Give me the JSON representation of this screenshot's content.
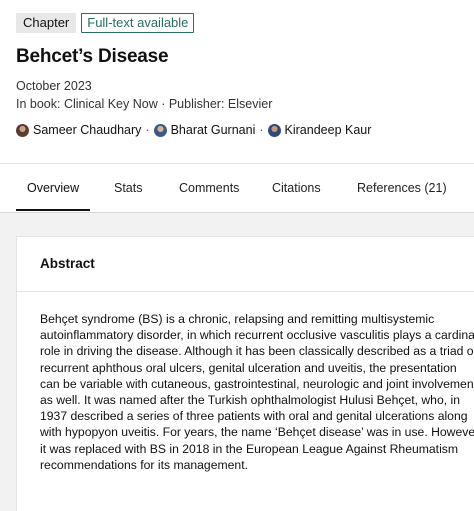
{
  "badges": {
    "chapter": "Chapter",
    "fulltext": "Full-text available"
  },
  "title": "Behcet’s Disease",
  "date": "October 2023",
  "book_line": "In book: Clinical Key Now · Publisher: Elsevier",
  "authors": [
    {
      "name": "Sameer Chaudhary",
      "icon": "author-avatar"
    },
    {
      "name": "Bharat Gurnani",
      "icon": "author-avatar"
    },
    {
      "name": "Kirandeep Kaur",
      "icon": "author-avatar"
    }
  ],
  "author_separator": "·",
  "tabs": [
    {
      "label": "Overview",
      "active": true
    },
    {
      "label": "Stats"
    },
    {
      "label": "Comments"
    },
    {
      "label": "Citations"
    },
    {
      "label": "References (21)"
    }
  ],
  "abstract": {
    "heading": "Abstract",
    "lines": [
      "Behçet syndrome (BS) is a chronic, relapsing and remitting multisystemic",
      "autoinflammatory disorder, in which recurrent occlusive vasculitis plays a cardinal",
      "role in driving the disease. Although it has been classically described as a triad of",
      "recurrent aphthous oral ulcers, genital ulceration and uveitis, the presentation",
      "can be variable with cutaneous, gastrointestinal, neurologic and joint involvement",
      "as well. It was named after the Turkish ophthalmologist Hulusi Behçet, who, in",
      "1937 described a series of three patients with oral and genital ulcerations along",
      "with hypopyon uveitis. For years, the name ‘Behçet disease’ was in use. However,",
      "it was replaced with BS in 2018 in the European League Against Rheumatism",
      "recommendations for its management."
    ]
  },
  "colors": {
    "accent": "#2a6e62",
    "tab_underline": "#111111",
    "background_gray": "#f2f2f2"
  }
}
